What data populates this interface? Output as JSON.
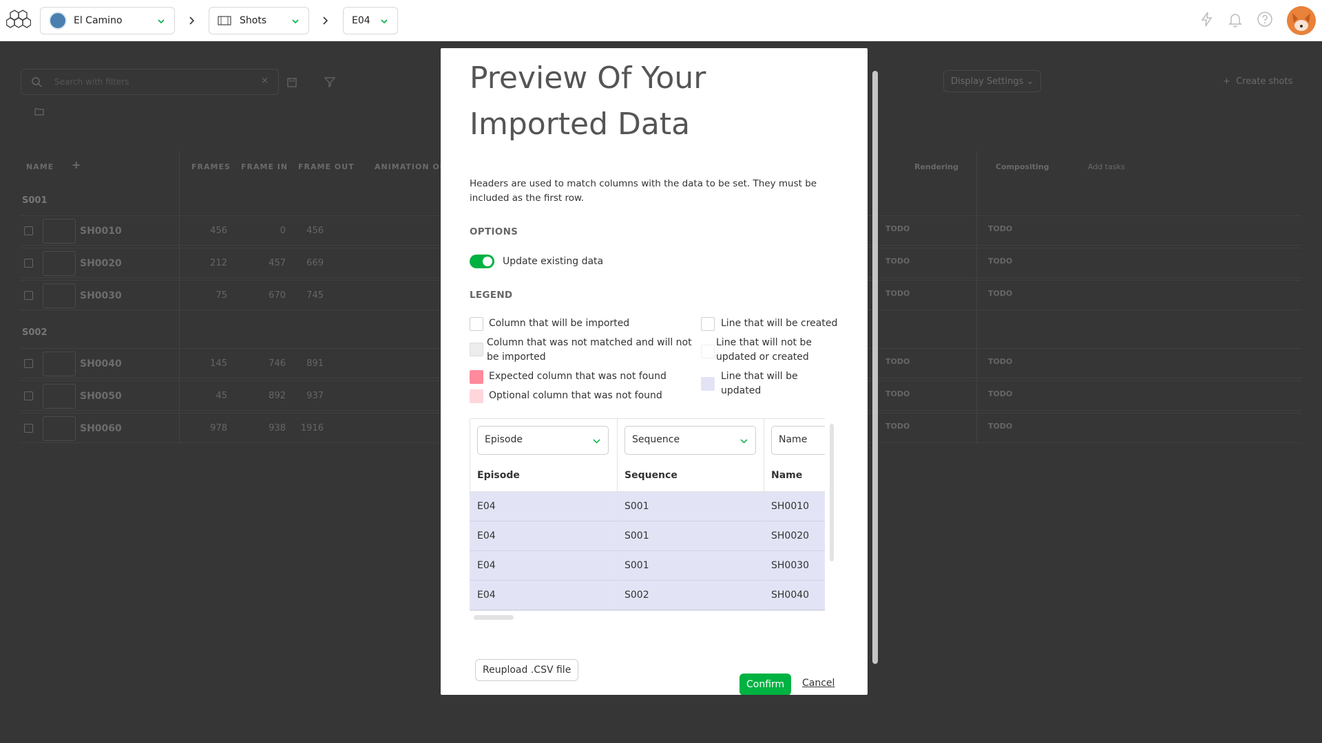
{
  "topbar": {
    "production": "El Camino",
    "section": "Shots",
    "episode": "E04"
  },
  "background": {
    "search_placeholder": "Search with filters",
    "display_settings": "Display Settings",
    "create_shots": "Create shots",
    "headers": {
      "name": "NAME",
      "frames": "FRAMES",
      "frame_in": "FRAME IN",
      "frame_out": "FRAME OUT",
      "animation": "ANIMATION OR",
      "rendering": "Rendering",
      "compositing": "Compositing",
      "add_tasks": "Add tasks"
    },
    "groups": [
      {
        "name": "S001",
        "rows": [
          {
            "shot": "SH0010",
            "frames": "456",
            "in": "0",
            "out": "456",
            "render": "TODO",
            "comp": "TODO"
          },
          {
            "shot": "SH0020",
            "frames": "212",
            "in": "457",
            "out": "669",
            "render": "TODO",
            "comp": "TODO"
          },
          {
            "shot": "SH0030",
            "frames": "75",
            "in": "670",
            "out": "745",
            "render": "TODO",
            "comp": "TODO"
          }
        ]
      },
      {
        "name": "S002",
        "rows": [
          {
            "shot": "SH0040",
            "frames": "145",
            "in": "746",
            "out": "891",
            "render": "TODO",
            "comp": "TODO"
          },
          {
            "shot": "SH0050",
            "frames": "45",
            "in": "892",
            "out": "937",
            "render": "TODO",
            "comp": "TODO"
          },
          {
            "shot": "SH0060",
            "frames": "978",
            "in": "938",
            "out": "1916",
            "render": "TODO",
            "comp": "TODO"
          }
        ]
      }
    ]
  },
  "modal": {
    "title": "Preview Of Your Imported Data",
    "description": "Headers are used to match columns with the data to be set. They must be included as the first row.",
    "options_label": "OPTIONS",
    "toggle_label": "Update existing data",
    "legend_label": "LEGEND",
    "legend": {
      "col_imported": "Column that will be imported",
      "col_not_matched": "Column that was not matched and will not be imported",
      "col_expected_missing": "Expected column that was not found",
      "col_optional_missing": "Optional column that was not found",
      "line_created": "Line that will be created",
      "line_not_updated": "Line that will not be updated or created",
      "line_updated": "Line that will be updated"
    },
    "table": {
      "columns": [
        {
          "select": "Episode",
          "header": "Episode"
        },
        {
          "select": "Sequence",
          "header": "Sequence"
        },
        {
          "select": "Name",
          "header": "Name"
        }
      ],
      "rows": [
        [
          "E04",
          "S001",
          "SH0010"
        ],
        [
          "E04",
          "S001",
          "SH0020"
        ],
        [
          "E04",
          "S001",
          "SH0030"
        ],
        [
          "E04",
          "S002",
          "SH0040"
        ]
      ]
    },
    "reupload_label": "Reupload .CSV file",
    "confirm_label": "Confirm",
    "cancel_label": "Cancel"
  },
  "colors": {
    "accent_green": "#00b242",
    "line_updated": "#e2e4f6",
    "expected_missing": "#ff8a9b",
    "optional_missing": "#ffd6dc",
    "not_matched": "#ececec"
  }
}
